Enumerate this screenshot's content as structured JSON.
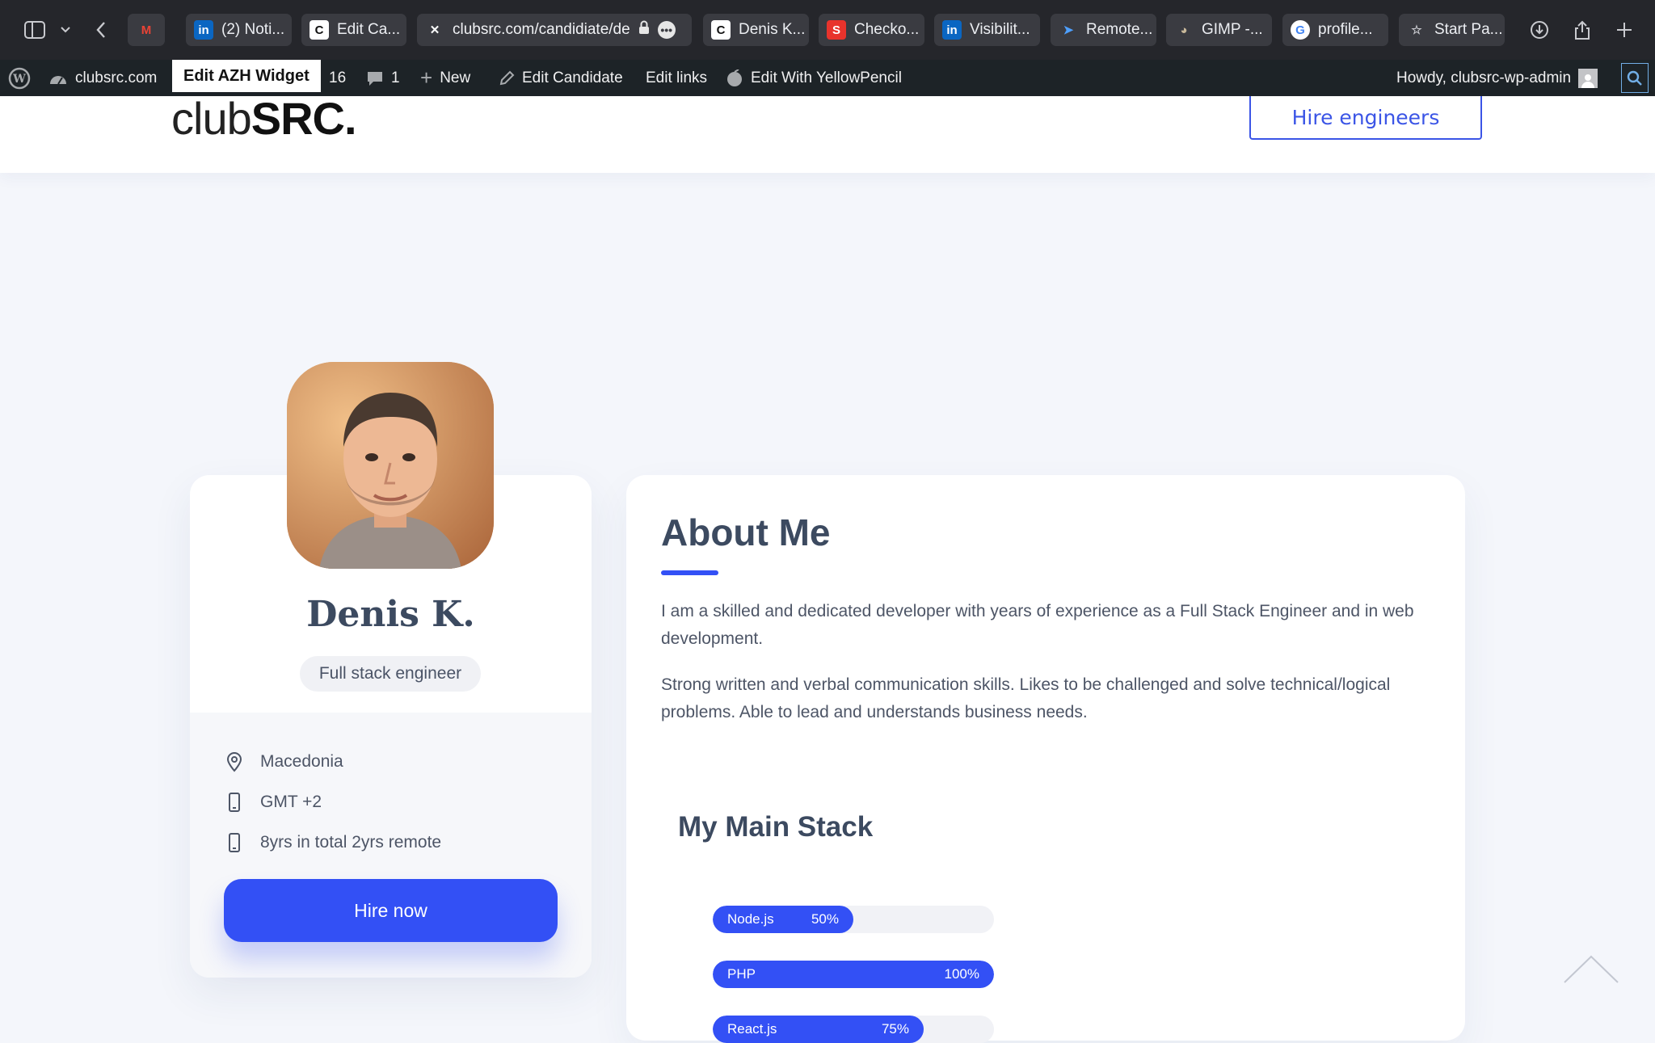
{
  "browser": {
    "tabs": [
      {
        "label": "",
        "icon": "gmail-icon"
      },
      {
        "label": "(2) Noti...",
        "icon": "linkedin-icon"
      },
      {
        "label": "Edit Ca...",
        "icon": "clubsrc-icon"
      },
      {
        "label": "Denis K...",
        "icon": "clubsrc-icon"
      },
      {
        "label": "Checko...",
        "icon": "checkout-icon"
      },
      {
        "label": "Visibilit...",
        "icon": "linkedin-icon"
      },
      {
        "label": "Remote...",
        "icon": "rocket-icon"
      },
      {
        "label": "GIMP -...",
        "icon": "gimp-icon"
      },
      {
        "label": "profile...",
        "icon": "google-icon"
      },
      {
        "label": "Start Pa...",
        "icon": "star-icon"
      }
    ],
    "address": "clubsrc.com/candidiate/de"
  },
  "adminbar": {
    "site": "clubsrc.com",
    "tooltip": "Edit AZH Widget",
    "updates": "16",
    "comments": "1",
    "new": "New",
    "edit_candidate": "Edit Candidate",
    "edit_links": "Edit links",
    "yellowpencil": "Edit With YellowPencil",
    "howdy": "Howdy, clubsrc-wp-admin"
  },
  "header": {
    "logo_light": "club",
    "logo_bold": "SRC.",
    "hire_button": "Hire engineers"
  },
  "profile": {
    "name": "Denis K.",
    "role": "Full stack engineer",
    "location": "Macedonia",
    "timezone": "GMT +2",
    "experience": "8yrs in total 2yrs remote",
    "hire_button": "Hire now"
  },
  "about": {
    "title": "About Me",
    "paragraphs": [
      "I am a skilled and dedicated developer with years of experience as a Full Stack Engineer and in web development.",
      "Strong written and verbal communication skills. Likes to be challenged and solve technical/logical problems. Able to lead and understands business needs."
    ],
    "stack_title": "My Main Stack",
    "skills": [
      {
        "name": "Node.js",
        "percent_label": "50%",
        "level": 0.5
      },
      {
        "name": "PHP",
        "percent_label": "100%",
        "level": 1.0
      },
      {
        "name": "React.js",
        "percent_label": "75%",
        "level": 0.75
      }
    ]
  },
  "colors": {
    "accent": "#3350f5",
    "heading": "#3c4a60",
    "body_bg": "#f4f6fb"
  }
}
